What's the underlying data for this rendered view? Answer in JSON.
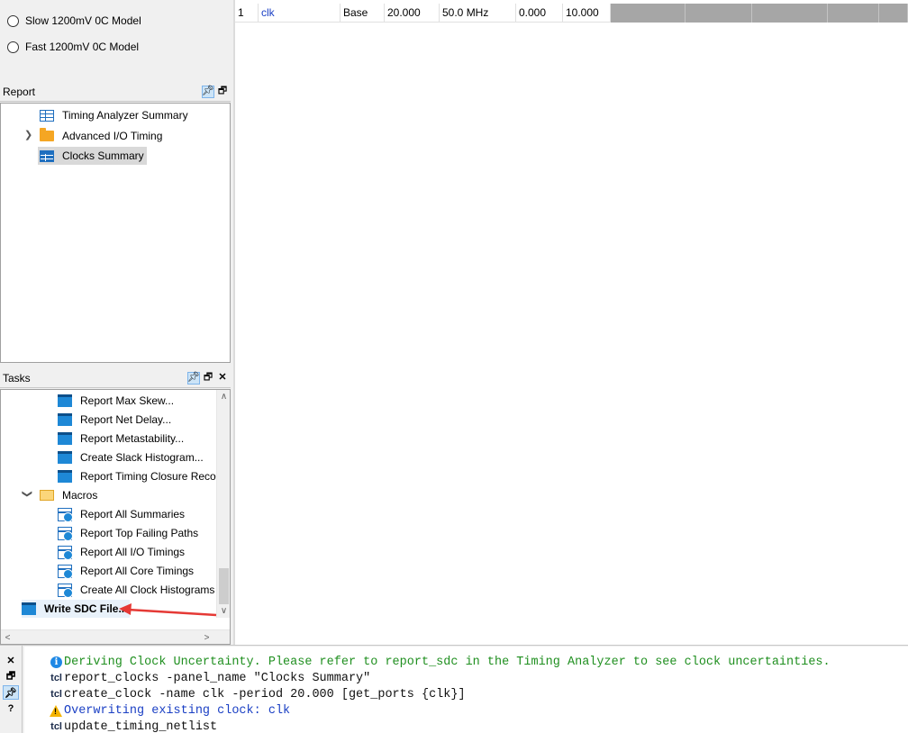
{
  "corners": {
    "slow_label": "Slow 1200mV 0C Model",
    "fast_label": "Fast 1200mV 0C Model"
  },
  "report_panel": {
    "title": "Report",
    "items": [
      {
        "label": "Timing Analyzer Summary",
        "icon": "table-icon"
      },
      {
        "label": "Advanced I/O Timing",
        "icon": "folder-icon"
      },
      {
        "label": "Clocks Summary",
        "icon": "table-icon",
        "selected": true
      }
    ]
  },
  "tasks_panel": {
    "title": "Tasks",
    "items": [
      {
        "label": "Report Max Skew...",
        "icon": "task-icon"
      },
      {
        "label": "Report Net Delay...",
        "icon": "task-icon"
      },
      {
        "label": "Report Metastability...",
        "icon": "task-icon"
      },
      {
        "label": "Create Slack Histogram...",
        "icon": "task-icon"
      },
      {
        "label": "Report Timing Closure Recommendations...",
        "icon": "task-icon"
      },
      {
        "label": "Macros",
        "icon": "folder-open-icon"
      },
      {
        "label": "Report All Summaries",
        "icon": "macro-icon"
      },
      {
        "label": "Report Top Failing Paths",
        "icon": "macro-icon"
      },
      {
        "label": "Report All I/O Timings",
        "icon": "macro-icon"
      },
      {
        "label": "Report All Core Timings",
        "icon": "macro-icon"
      },
      {
        "label": "Create All Clock Histograms",
        "icon": "macro-icon"
      },
      {
        "label": "Write SDC File...",
        "icon": "task-icon"
      }
    ]
  },
  "clocks_table": {
    "row": {
      "index": "1",
      "clock_name": "clk",
      "type": "Base",
      "period": "20.000",
      "frequency": "50.0 MHz",
      "rise": "0.000",
      "fall": "10.000"
    }
  },
  "console": {
    "lines": [
      {
        "prefix": "info-icon",
        "text": "Deriving Clock Uncertainty. Please refer to report_sdc in the Timing Analyzer to see clock uncertainties.",
        "color": "#1f8f1f"
      },
      {
        "prefix": "tcl",
        "text": "report_clocks -panel_name \"Clocks Summary\"",
        "color": "#111111"
      },
      {
        "prefix": "tcl",
        "text": "create_clock -name clk -period 20.000 [get_ports {clk}]",
        "color": "#111111"
      },
      {
        "prefix": "warning-icon",
        "text": "Overwriting existing clock: clk",
        "color": "#1a3fc4"
      },
      {
        "prefix": "tcl",
        "text": "update_timing_netlist",
        "color": "#111111"
      }
    ],
    "tcl_label": "tcl"
  },
  "annotation": {
    "arrow_color": "#e53935"
  }
}
